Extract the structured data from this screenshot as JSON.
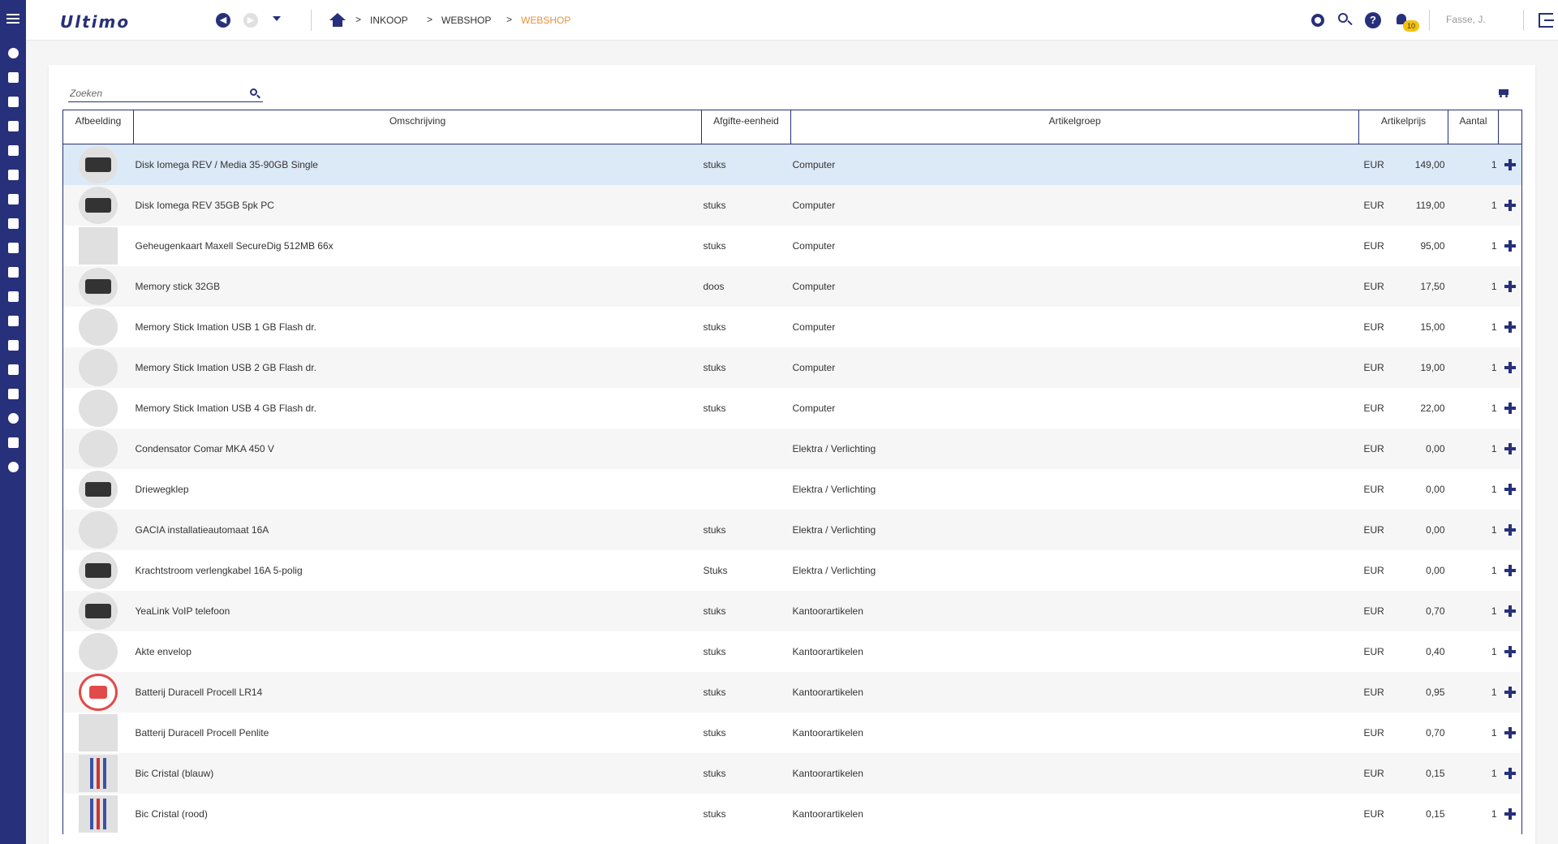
{
  "app": {
    "logo": "Ultimo"
  },
  "header": {
    "breadcrumb": [
      "INKOOP",
      "WEBSHOP",
      "WEBSHOP"
    ],
    "crumb_sep": ">",
    "help_label": "?",
    "notifications_count": "10",
    "user_name": "Fasse, J."
  },
  "colors": {
    "brand": "#27307a",
    "accent": "#e8913a",
    "badge": "#f4c20d",
    "selected_row": "#dce9f7"
  },
  "search": {
    "placeholder": "Zoeken"
  },
  "table": {
    "columns": [
      "Afbeelding",
      "Omschrijving",
      "Afgifte-eenheid",
      "Artikelgroep",
      "Artikelprijs",
      "Aantal"
    ],
    "rows": [
      {
        "desc": "Disk Iomega REV / Media 35-90GB Single",
        "unit": "stuks",
        "group": "Computer",
        "cur": "EUR",
        "price": "149,00",
        "qty": "1"
      },
      {
        "desc": "Disk Iomega REV 35GB 5pk PC",
        "unit": "stuks",
        "group": "Computer",
        "cur": "EUR",
        "price": "119,00",
        "qty": "1"
      },
      {
        "desc": "Geheugenkaart Maxell SecureDig 512MB 66x",
        "unit": "stuks",
        "group": "Computer",
        "cur": "EUR",
        "price": "95,00",
        "qty": "1"
      },
      {
        "desc": "Memory stick 32GB",
        "unit": "doos",
        "group": "Computer",
        "cur": "EUR",
        "price": "17,50",
        "qty": "1"
      },
      {
        "desc": "Memory Stick Imation USB 1 GB Flash dr.",
        "unit": "stuks",
        "group": "Computer",
        "cur": "EUR",
        "price": "15,00",
        "qty": "1"
      },
      {
        "desc": "Memory Stick Imation USB 2 GB Flash dr.",
        "unit": "stuks",
        "group": "Computer",
        "cur": "EUR",
        "price": "19,00",
        "qty": "1"
      },
      {
        "desc": "Memory Stick Imation USB 4 GB Flash dr.",
        "unit": "stuks",
        "group": "Computer",
        "cur": "EUR",
        "price": "22,00",
        "qty": "1"
      },
      {
        "desc": "Condensator Comar MKA 450 V",
        "unit": "",
        "group": "Elektra / Verlichting",
        "cur": "EUR",
        "price": "0,00",
        "qty": "1"
      },
      {
        "desc": "Driewegklep",
        "unit": "",
        "group": "Elektra / Verlichting",
        "cur": "EUR",
        "price": "0,00",
        "qty": "1"
      },
      {
        "desc": "GACIA installatieautomaat 16A",
        "unit": "stuks",
        "group": "Elektra / Verlichting",
        "cur": "EUR",
        "price": "0,00",
        "qty": "1"
      },
      {
        "desc": "Krachtstroom verlengkabel 16A 5-polig",
        "unit": "Stuks",
        "group": "Elektra / Verlichting",
        "cur": "EUR",
        "price": "0,00",
        "qty": "1"
      },
      {
        "desc": "YeaLink VoIP telefoon",
        "unit": "stuks",
        "group": "Kantoorartikelen",
        "cur": "EUR",
        "price": "0,70",
        "qty": "1"
      },
      {
        "desc": "Akte envelop",
        "unit": "stuks",
        "group": "Kantoorartikelen",
        "cur": "EUR",
        "price": "0,40",
        "qty": "1"
      },
      {
        "desc": "Batterij Duracell Procell LR14",
        "unit": "stuks",
        "group": "Kantoorartikelen",
        "cur": "EUR",
        "price": "0,95",
        "qty": "1"
      },
      {
        "desc": "Batterij Duracell Procell Penlite",
        "unit": "stuks",
        "group": "Kantoorartikelen",
        "cur": "EUR",
        "price": "0,70",
        "qty": "1"
      },
      {
        "desc": "Bic Cristal (blauw)",
        "unit": "stuks",
        "group": "Kantoorartikelen",
        "cur": "EUR",
        "price": "0,15",
        "qty": "1"
      },
      {
        "desc": "Bic Cristal (rood)",
        "unit": "stuks",
        "group": "Kantoorartikelen",
        "cur": "EUR",
        "price": "0,15",
        "qty": "1"
      }
    ]
  }
}
